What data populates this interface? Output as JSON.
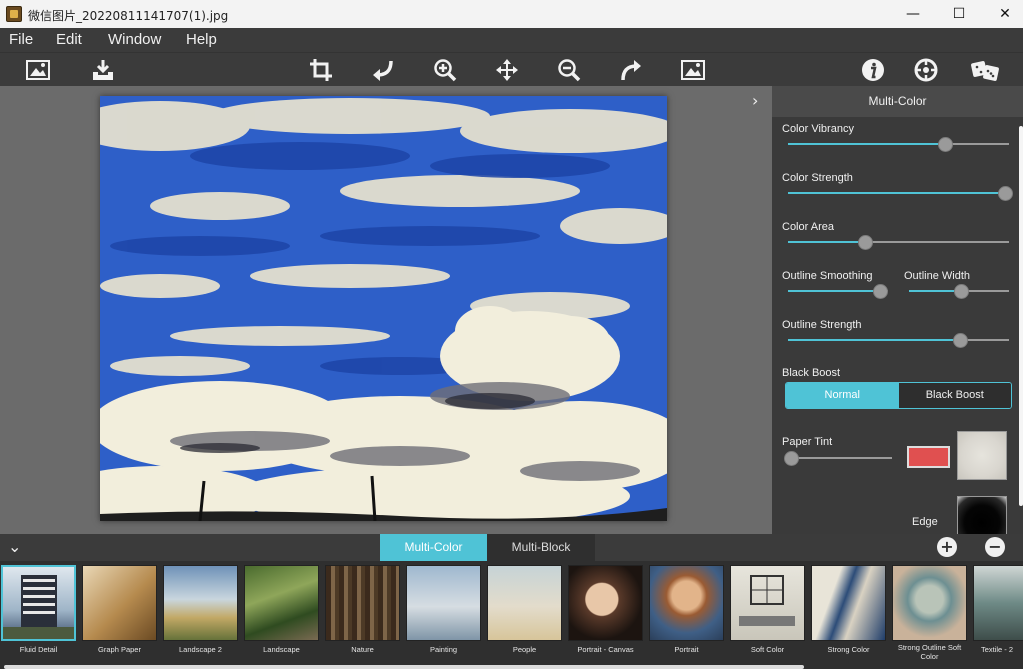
{
  "window": {
    "title": "微信图片_20220811141707(1).jpg",
    "minimize": "—",
    "maximize": "☐",
    "close": "✕"
  },
  "menu": [
    "File",
    "Edit",
    "Window",
    "Help"
  ],
  "toolbar": {
    "icons": [
      "open-image-icon",
      "save-icon",
      "crop-icon",
      "undo-icon",
      "zoom-in-icon",
      "move-icon",
      "zoom-out-icon",
      "redo-icon",
      "fit-image-icon",
      "info-icon",
      "settings-icon",
      "randomize-dice-icon"
    ]
  },
  "accent": "#4fc3d6",
  "panel": {
    "title": "Multi-Color",
    "sliders": {
      "color_vibrancy": {
        "label": "Color Vibrancy",
        "value": 0.71
      },
      "color_strength": {
        "label": "Color Strength",
        "value": 0.98
      },
      "color_area": {
        "label": "Color Area",
        "value": 0.35
      },
      "outline_smoothing": {
        "label": "Outline Smoothing",
        "value": 0.92
      },
      "outline_width": {
        "label": "Outline Width",
        "value": 0.52
      },
      "outline_strength": {
        "label": "Outline Strength",
        "value": 0.78
      },
      "paper_tint": {
        "label": "Paper Tint",
        "value": 0.03
      }
    },
    "black_boost": {
      "label": "Black Boost",
      "options": [
        "Normal",
        "Black Boost"
      ],
      "selected": "Normal"
    },
    "paper_tint_color": "#e05050",
    "edge_label": "Edge"
  },
  "tabs": {
    "active": "Multi-Color",
    "inactive": "Multi-Block"
  },
  "zoom_buttons": {
    "plus": "+",
    "minus": "−"
  },
  "presets": [
    {
      "label": "Fluid Detail",
      "selected": true
    },
    {
      "label": "Graph Paper"
    },
    {
      "label": "Landscape 2"
    },
    {
      "label": "Landscape"
    },
    {
      "label": "Nature"
    },
    {
      "label": "Painting"
    },
    {
      "label": "People"
    },
    {
      "label": "Portrait - Canvas"
    },
    {
      "label": "Portrait"
    },
    {
      "label": "Soft Color"
    },
    {
      "label": "Strong Color"
    },
    {
      "label": "Strong Outline Soft Color"
    },
    {
      "label": "Textile - 2"
    }
  ]
}
